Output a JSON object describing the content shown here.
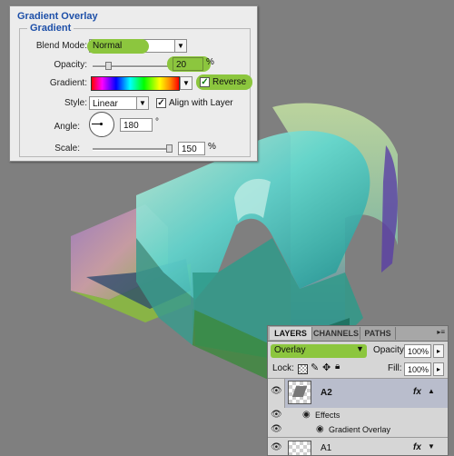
{
  "gradient_overlay": {
    "title": "Gradient Overlay",
    "group_title": "Gradient",
    "blend_mode_label": "Blend Mode:",
    "blend_mode_value": "Normal",
    "opacity_label": "Opacity:",
    "opacity_value": "20",
    "opacity_unit": "%",
    "opacity_level": 0.2,
    "gradient_label": "Gradient:",
    "reverse_label": "Reverse",
    "reverse_checked": true,
    "style_label": "Style:",
    "style_value": "Linear",
    "align_label": "Align with Layer",
    "align_checked": true,
    "angle_label": "Angle:",
    "angle_value": "180",
    "angle_unit": "°",
    "scale_label": "Scale:",
    "scale_value": "150",
    "scale_unit": "%",
    "scale_level": 1.0
  },
  "layers_panel": {
    "tabs": [
      "LAYERS",
      "CHANNELS",
      "PATHS"
    ],
    "active_tab": "LAYERS",
    "blend_mode": "Overlay",
    "opacity_label": "Opacity:",
    "opacity_value": "100%",
    "lock_label": "Lock:",
    "fill_label": "Fill:",
    "fill_value": "100%",
    "layers": [
      {
        "name": "A2",
        "fx": "fx",
        "selected": true
      },
      {
        "name": "A1",
        "fx": "fx",
        "selected": false
      }
    ],
    "effects_label": "Effects",
    "effect_item": "Gradient Overlay"
  },
  "colors": {
    "highlight": "#8cc63e",
    "title_blue": "#1d4fa8",
    "canvas_bg": "#7f7f7f"
  }
}
